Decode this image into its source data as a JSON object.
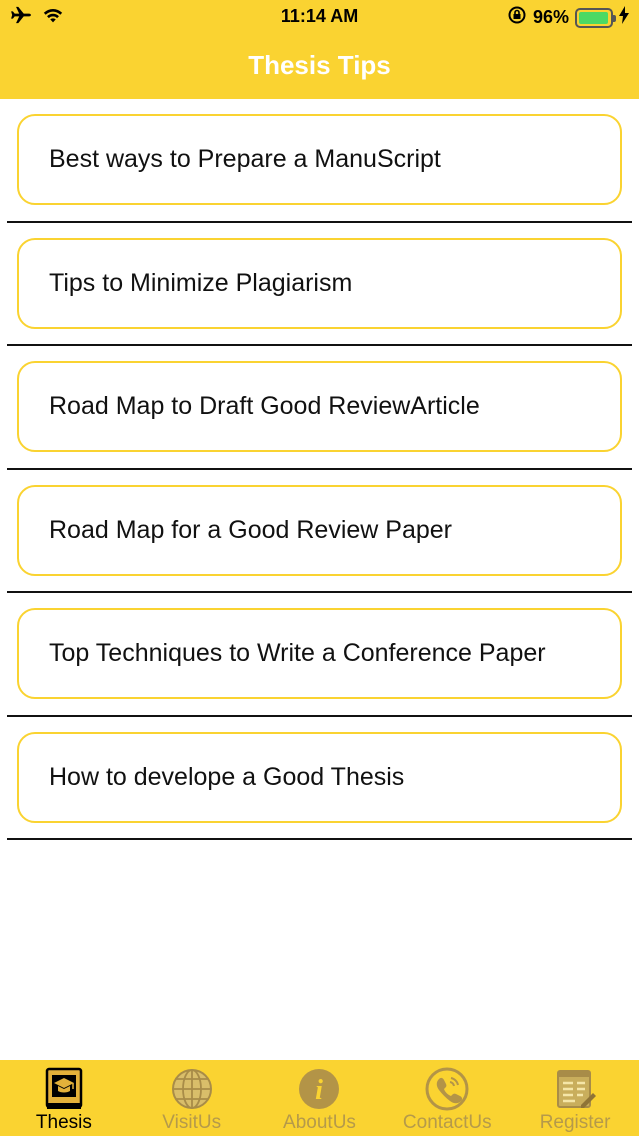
{
  "status_bar": {
    "time": "11:14 AM",
    "battery_percent": "96%",
    "battery_level": 0.96
  },
  "header": {
    "title": "Thesis Tips"
  },
  "tips": [
    {
      "label": "Best ways to Prepare a ManuScript"
    },
    {
      "label": "Tips to Minimize Plagiarism"
    },
    {
      "label": "Road Map to Draft Good ReviewArticle"
    },
    {
      "label": "Road Map for a Good Review Paper"
    },
    {
      "label": "Top Techniques to Write a Conference Paper"
    },
    {
      "label": "How to develope a Good Thesis"
    }
  ],
  "tabbar": {
    "tabs": [
      {
        "label": "Thesis",
        "icon": "thesis-book-icon",
        "active": true
      },
      {
        "label": "VisitUs",
        "icon": "globe-icon",
        "active": false
      },
      {
        "label": "AboutUs",
        "icon": "info-icon",
        "active": false
      },
      {
        "label": "ContactUs",
        "icon": "phone-icon",
        "active": false
      },
      {
        "label": "Register",
        "icon": "register-form-icon",
        "active": false
      }
    ]
  },
  "colors": {
    "accent": "#FAD331",
    "tab_inactive": "#B59A4A",
    "tab_active": "#000000",
    "battery": "#4CD964"
  }
}
